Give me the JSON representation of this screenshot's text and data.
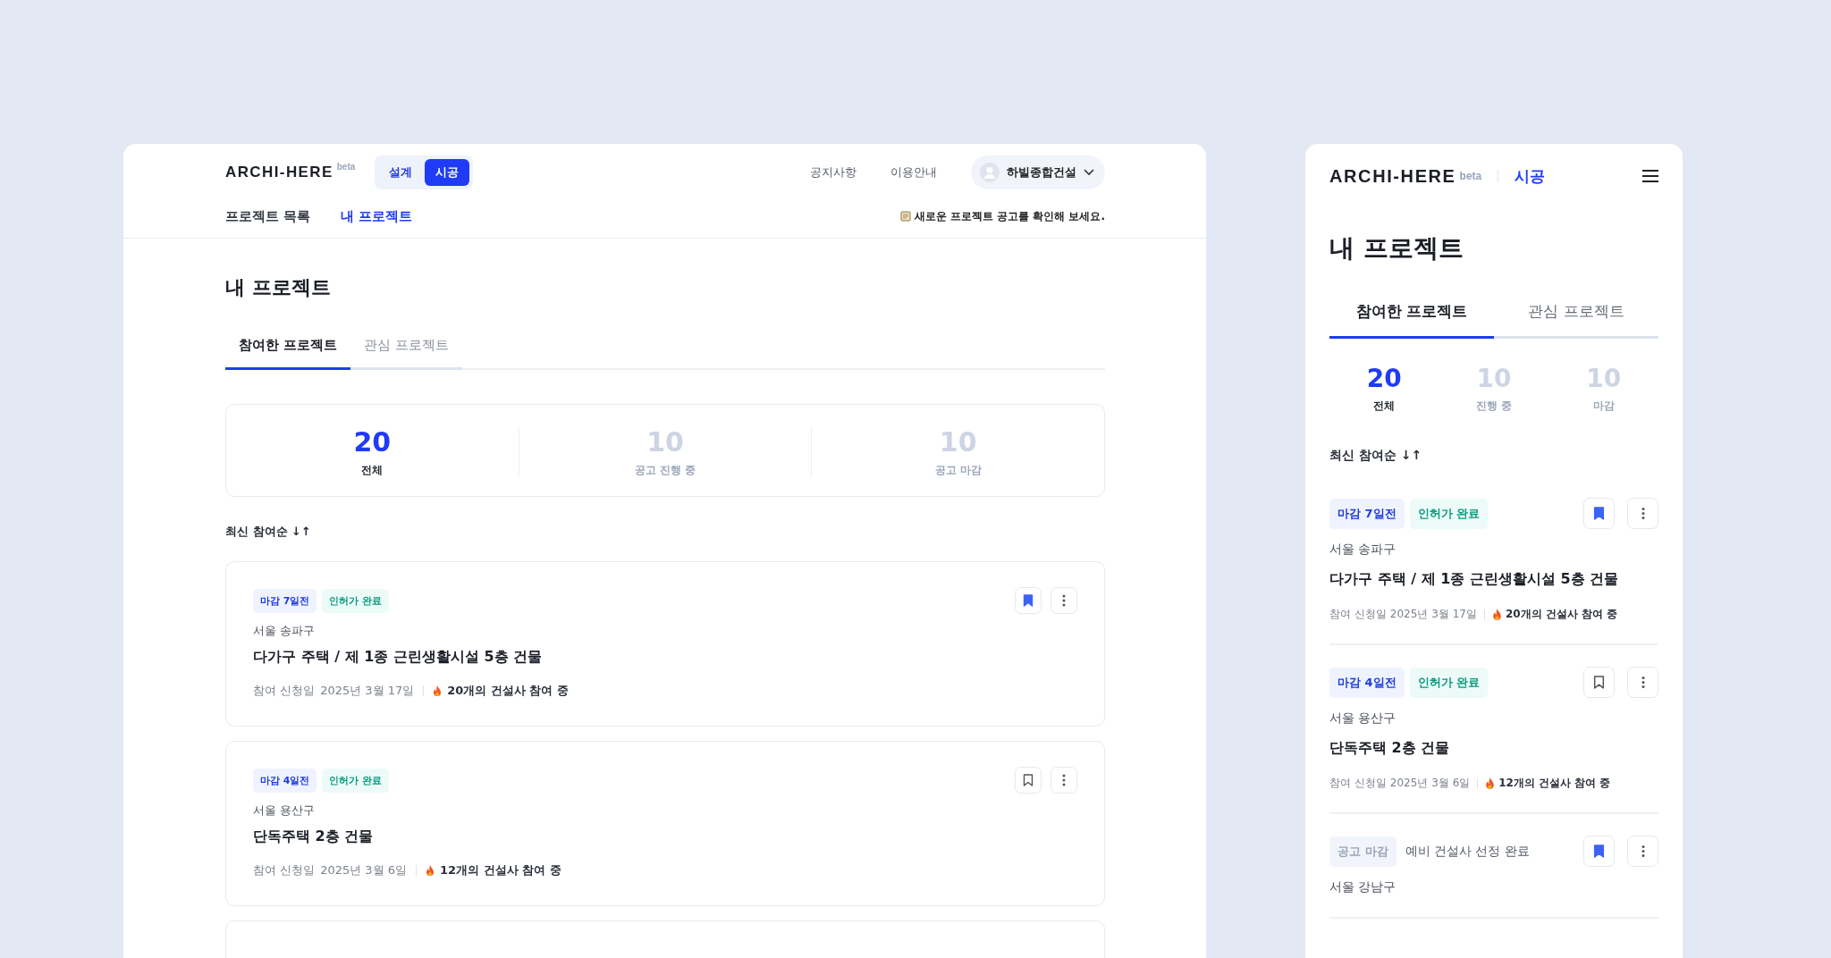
{
  "desktop": {
    "logo": "ARCHI-HERE",
    "logo_badge": "beta",
    "mode_toggle": [
      {
        "label": "설계",
        "selected": false
      },
      {
        "label": "시공",
        "selected": true
      }
    ],
    "top_links": [
      "공지사항",
      "이용안내"
    ],
    "account": {
      "name": "하빌종합건설"
    },
    "nav": [
      {
        "label": "프로젝트 목록",
        "selected": false
      },
      {
        "label": "내 프로젝트",
        "selected": true
      }
    ],
    "notice": "새로운 프로젝트 공고를 확인해 보세요.",
    "page_title": "내 프로젝트",
    "tabs": [
      {
        "label": "참여한 프로젝트",
        "selected": true
      },
      {
        "label": "관심 프로젝트",
        "selected": false
      }
    ],
    "stats": [
      {
        "value": "20",
        "label": "전체",
        "selected": true
      },
      {
        "value": "10",
        "label": "공고 진행 중",
        "selected": false
      },
      {
        "value": "10",
        "label": "공고 마감",
        "selected": false
      }
    ],
    "sort": {
      "label": "최신 참여순",
      "icon": "↓↑"
    },
    "projects": [
      {
        "tags": [
          {
            "label": "마감 7일전",
            "kind": "deadline"
          },
          {
            "label": "인허가 완료",
            "kind": "permit"
          }
        ],
        "bookmarked": true,
        "location": "서울 송파구",
        "title": "다가구 주택 / 제 1종 근린생활시설 5층 건물",
        "applied_label": "참여 신청일",
        "applied_date": "2025년 3월 17일",
        "participants": "20개의 건설사 참여 중"
      },
      {
        "tags": [
          {
            "label": "마감 4일전",
            "kind": "deadline"
          },
          {
            "label": "인허가 완료",
            "kind": "permit"
          }
        ],
        "bookmarked": false,
        "location": "서울 용산구",
        "title": "단독주택 2층 건물",
        "applied_label": "참여 신청일",
        "applied_date": "2025년 3월 6일",
        "participants": "12개의 건설사 참여 중"
      }
    ]
  },
  "mobile": {
    "logo": "ARCHI-HERE",
    "logo_badge": "beta",
    "mode": "시공",
    "page_title": "내 프로젝트",
    "tabs": [
      {
        "label": "참여한 프로젝트",
        "selected": true
      },
      {
        "label": "관심 프로젝트",
        "selected": false
      }
    ],
    "stats": [
      {
        "value": "20",
        "label": "전체",
        "selected": true
      },
      {
        "value": "10",
        "label": "진행 중",
        "selected": false
      },
      {
        "value": "10",
        "label": "마감",
        "selected": false
      }
    ],
    "sort": {
      "label": "최신 참여순",
      "icon": "↓↑"
    },
    "projects": [
      {
        "tags": [
          {
            "label": "마감 7일전",
            "kind": "deadline"
          },
          {
            "label": "인허가 완료",
            "kind": "permit"
          }
        ],
        "bookmarked": true,
        "location": "서울 송파구",
        "title": "다가구 주택 / 제 1종 근린생활시설 5층 건물",
        "applied_label": "참여 신청일",
        "applied_date": "2025년 3월 17일",
        "participants": "20개의 건설사 참여 중"
      },
      {
        "tags": [
          {
            "label": "마감 4일전",
            "kind": "deadline"
          },
          {
            "label": "인허가 완료",
            "kind": "permit"
          }
        ],
        "bookmarked": false,
        "location": "서울 용산구",
        "title": "단독주택 2층 건물",
        "applied_label": "참여 신청일",
        "applied_date": "2025년 3월 6일",
        "participants": "12개의 건설사 참여 중"
      },
      {
        "tags": [
          {
            "label": "공고 마감",
            "kind": "closed"
          }
        ],
        "status": "예비 건설사 선정 완료",
        "bookmarked": true,
        "location": "서울 강남구"
      }
    ]
  }
}
